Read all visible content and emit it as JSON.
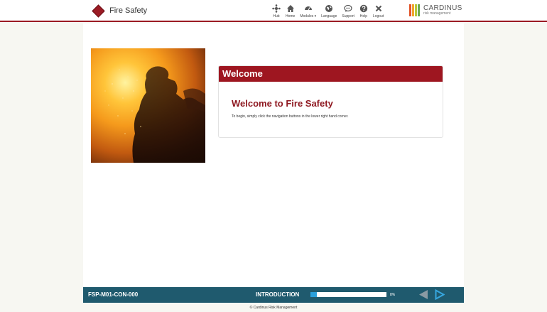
{
  "header": {
    "course_title": "Fire Safety",
    "nav": [
      {
        "label": "Hub",
        "icon": "hub-icon"
      },
      {
        "label": "Home",
        "icon": "home-icon"
      },
      {
        "label": "Modules ▾",
        "icon": "modules-icon"
      },
      {
        "label": "Language",
        "icon": "globe-icon"
      },
      {
        "label": "Support",
        "icon": "chat-icon"
      },
      {
        "label": "Help",
        "icon": "help-icon"
      },
      {
        "label": "Logout",
        "icon": "close-icon"
      }
    ],
    "logo": {
      "name": "CARDINUS",
      "sub": "risk management"
    }
  },
  "welcome": {
    "header": "Welcome",
    "title": "Welcome to Fire Safety",
    "body": "To begin, simply click the navigation buttons in the lower right hand corner."
  },
  "footer": {
    "module_code": "FSP-M01-CON-000",
    "section": "INTRODUCTION",
    "progress_percent": 8,
    "progress_label": "8%"
  },
  "copyright": "© Cardinus Risk Management",
  "colors": {
    "brand_red": "#9e1620",
    "footer_teal": "#1f5a6e",
    "progress_blue": "#2aa0dc",
    "arrow_blue": "#36a7df"
  }
}
